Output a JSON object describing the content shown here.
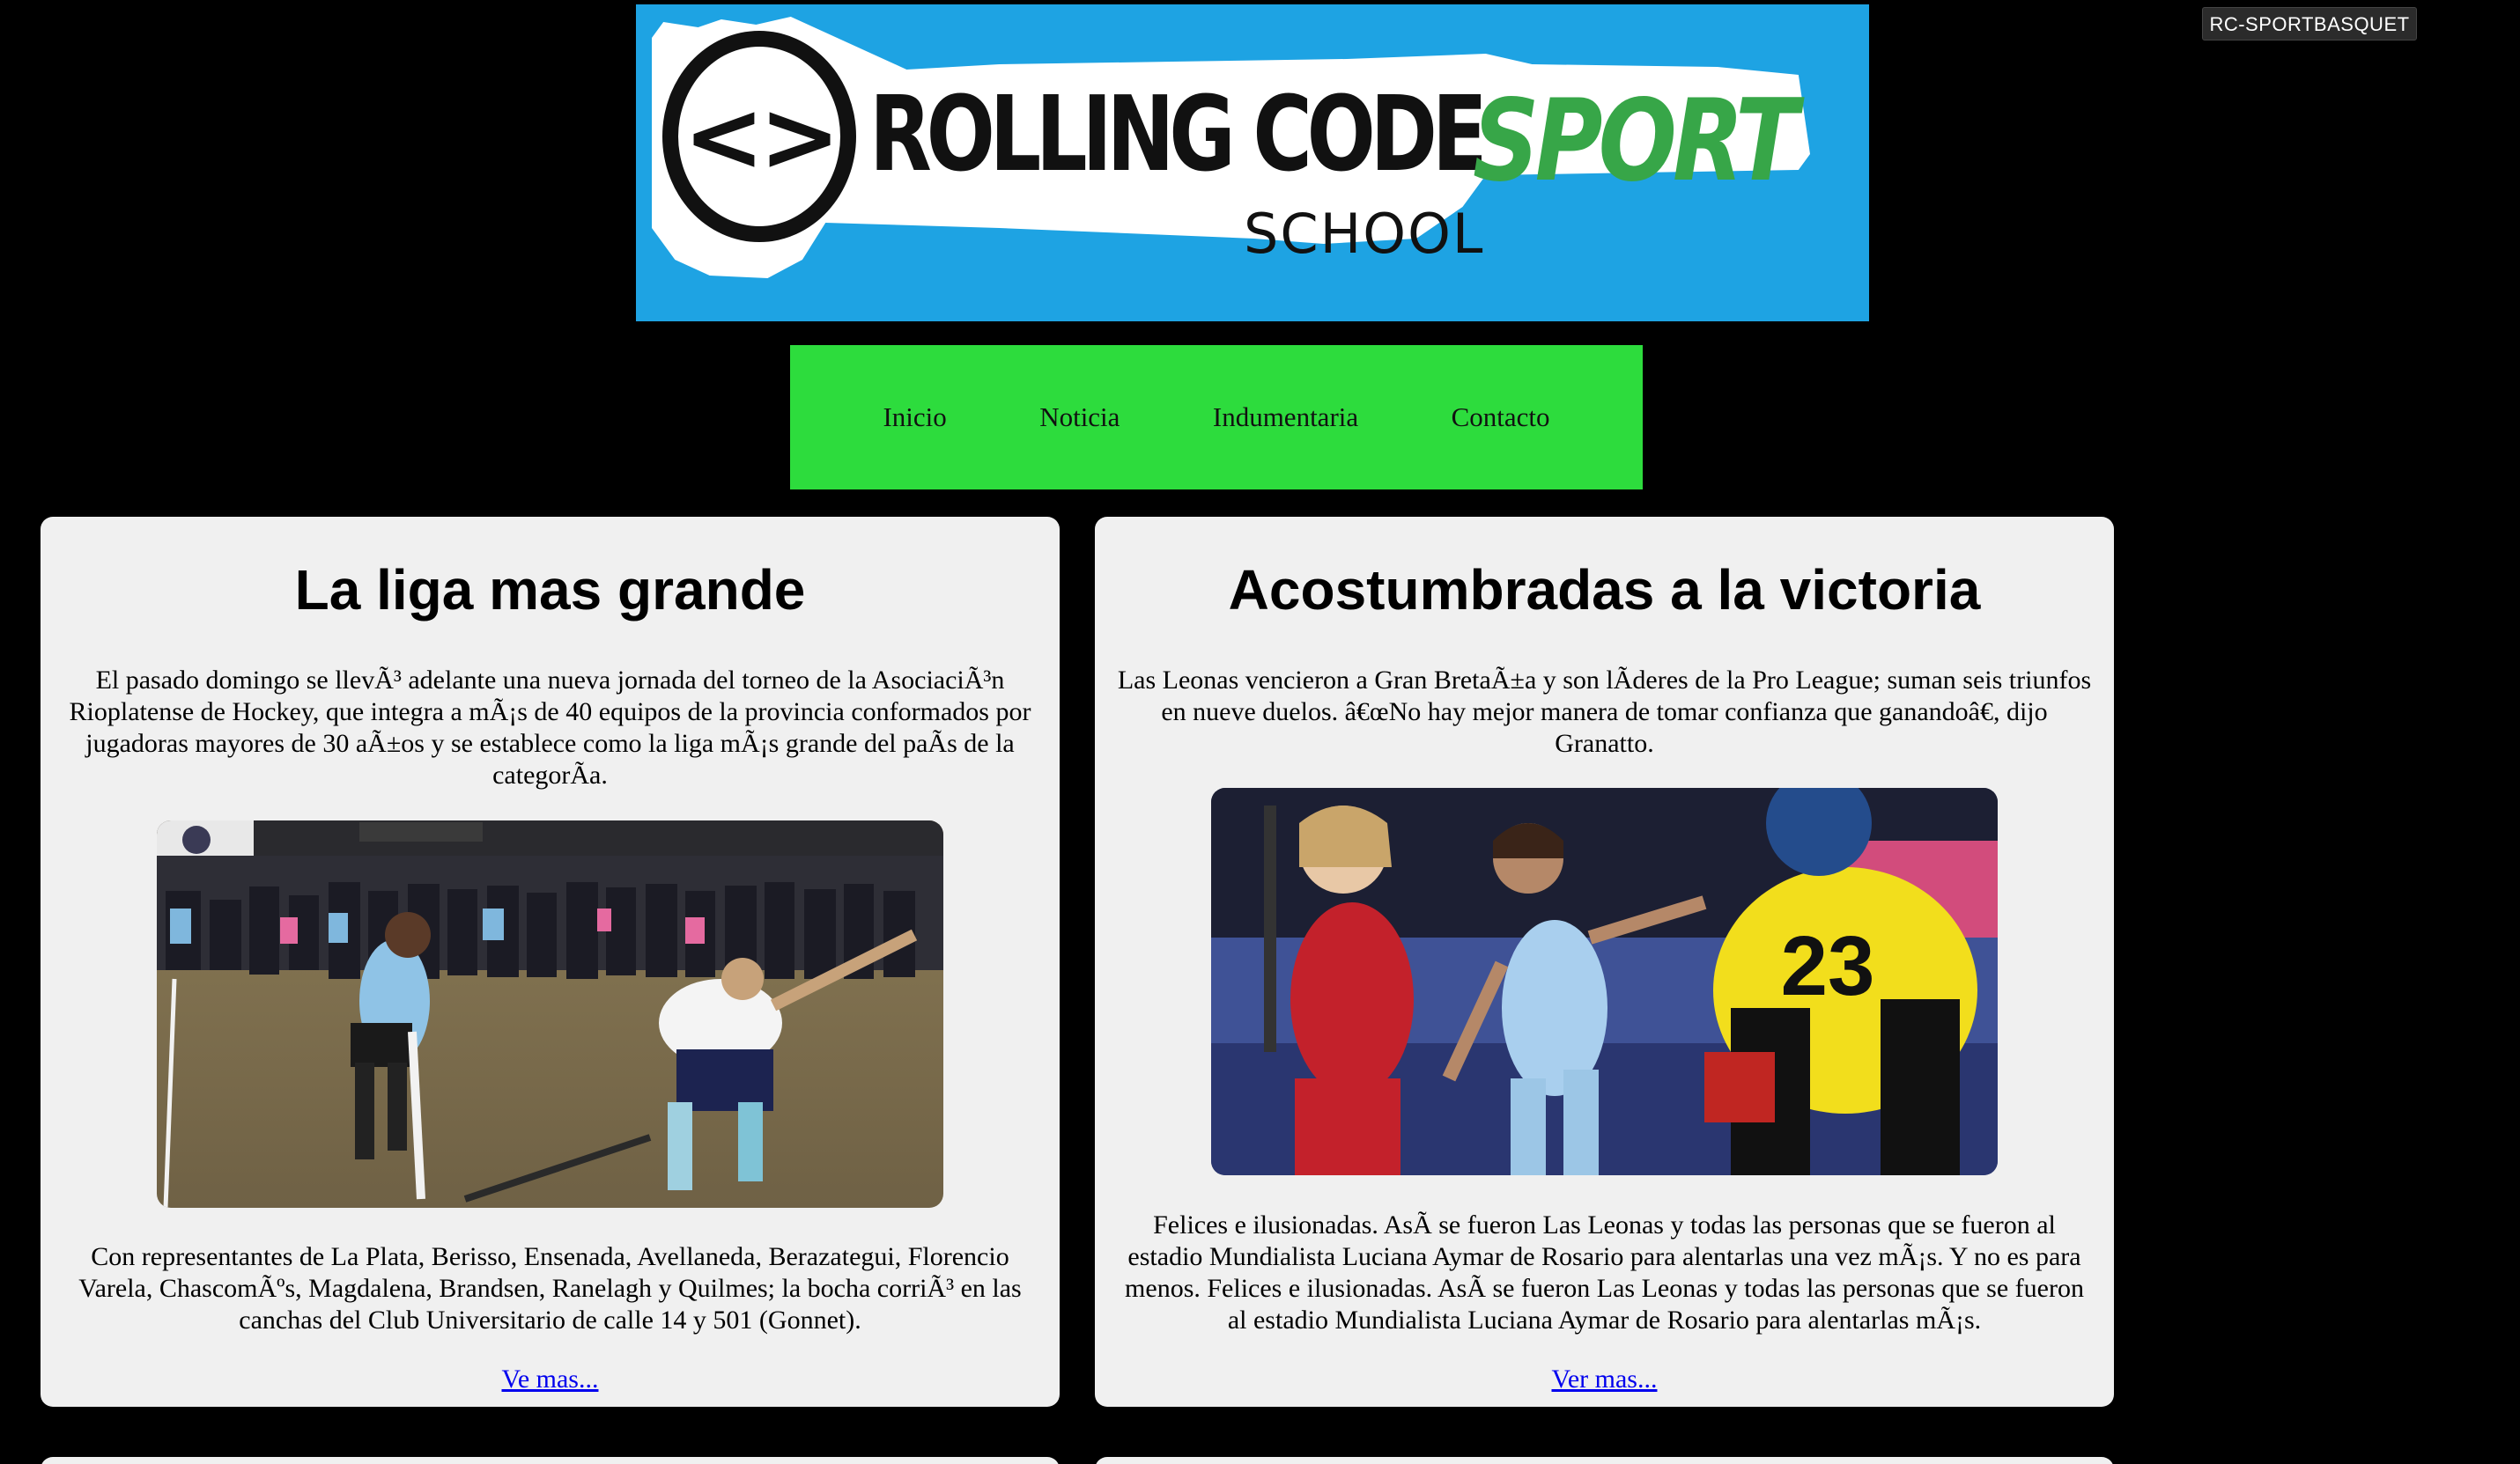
{
  "top_badge": {
    "label": "RC-SPORTBASQUET"
  },
  "logo": {
    "brand_left": "ROLLING CODE",
    "brand_right": "SPORT",
    "brand_sub": "SCHOOL",
    "code_glyph": "<>",
    "colors": {
      "banner": "#1ea3e3",
      "sport": "#37a648"
    }
  },
  "nav": {
    "background": "#2ddc3d",
    "items": [
      {
        "label": "Inicio"
      },
      {
        "label": "Noticia"
      },
      {
        "label": "Indumentaria"
      },
      {
        "label": "Contacto"
      }
    ]
  },
  "cards": [
    {
      "title": "La liga mas grande",
      "intro": "El pasado domingo se llevÃ³ adelante una nueva jornada del torneo de la AsociaciÃ³n Rioplatense de Hockey, que integra a mÃ¡s de 40 equipos de la provincia conformados por jugadoras mayores de 30 aÃ±os y se establece como la liga mÃ¡s grande del paÃs de la categorÃa.",
      "image": {
        "subject": "hockey-match-photo"
      },
      "outro": "Con representantes de La Plata, Berisso, Ensenada, Avellaneda, Berazategui, Florencio Varela, ChascomÃºs, Magdalena, Brandsen, Ranelagh y Quilmes; la bocha corriÃ³ en las canchas del Club Universitario de calle 14 y 501 (Gonnet).",
      "link": "Ve mas..."
    },
    {
      "title": "Acostumbradas a la victoria",
      "intro": "Las Leonas vencieron a Gran BretaÃ±a y son lÃderes de la Pro League; suman seis triunfos en nueve duelos. â€œNo hay mejor manera de tomar confianza que ganandoâ€, dijo Granatto.",
      "image": {
        "subject": "leonas-celebration-photo"
      },
      "outro": "Felices e ilusionadas. AsÃ se fueron Las Leonas y todas las personas que se fueron al estadio Mundialista Luciana Aymar de Rosario para alentarlas una vez mÃ¡s. Y no es para menos. Felices e ilusionadas. AsÃ se fueron Las Leonas y todas las personas que se fueron al estadio Mundialista Luciana Aymar de Rosario para alentarlas mÃ¡s.",
      "link": "Ver mas..."
    }
  ]
}
